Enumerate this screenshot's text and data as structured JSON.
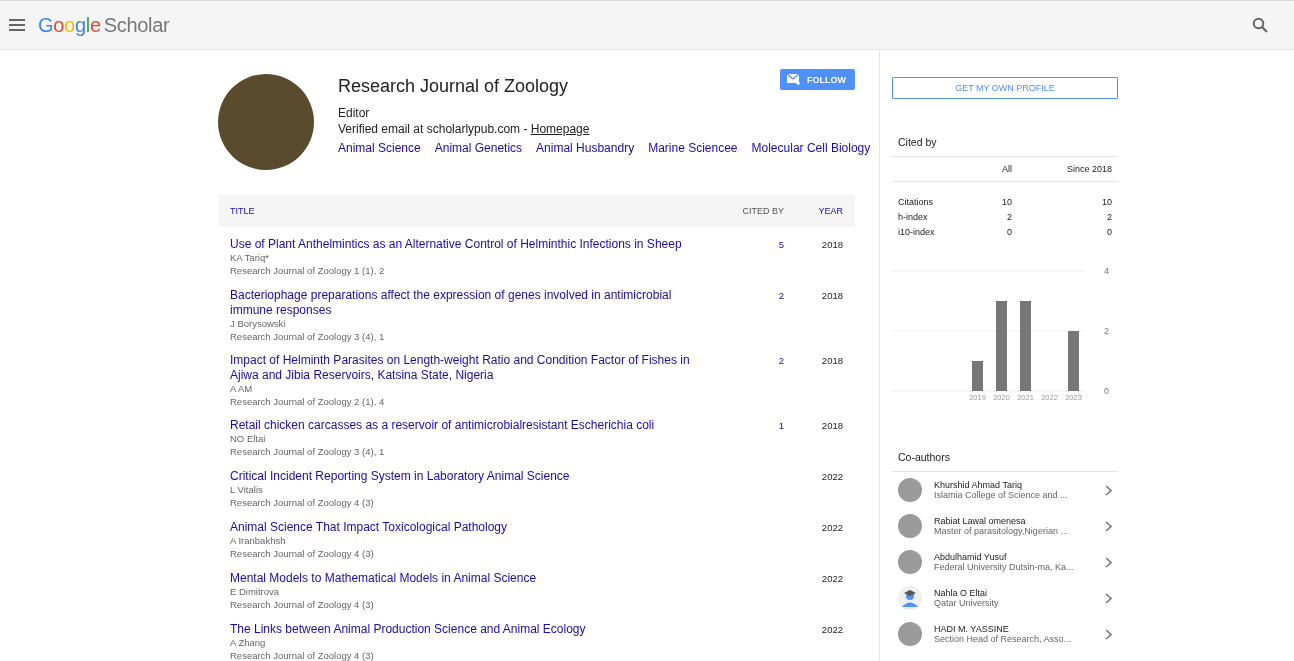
{
  "header": {
    "logo_brand": "Google",
    "logo_product": "Scholar"
  },
  "profile": {
    "name": "Research Journal of Zoology",
    "role": "Editor",
    "verified": "Verified email at scholarlypub.com - ",
    "homepage": "Homepage",
    "follow": "FOLLOW",
    "interests": [
      "Animal Science",
      "Animal Genetics",
      "Animal Husbandry",
      "Marine Sciencee",
      "Molecular Cell Biology"
    ]
  },
  "table": {
    "columns": [
      "TITLE",
      "CITED BY",
      "YEAR"
    ],
    "rows": [
      {
        "title": "Use of Plant Anthelmintics as an Alternative Control of Helminthic Infections in Sheep",
        "authors": "KA Tariq*",
        "source": "Research Journal of Zoology 1 (1), 2",
        "cited_by": "5",
        "year": "2018"
      },
      {
        "title": "Bacteriophage preparations affect the expression of genes involved in antimicrobial immune responses",
        "authors": "J Borysowski",
        "source": "Research Journal of Zoology 3 (4), 1",
        "cited_by": "2",
        "year": "2018"
      },
      {
        "title": "Impact of Helminth Parasites on Length-weight Ratio and Condition Factor of Fishes in Ajiwa and Jibia Reservoirs, Katsina State, Nigeria",
        "authors": "A AM",
        "source": "Research Journal of Zoology 2 (1), 4",
        "cited_by": "2",
        "year": "2018"
      },
      {
        "title": "Retail chicken carcasses as a reservoir of antimicrobialresistant Escherichia coli",
        "authors": "NO Eltai",
        "source": "Research Journal of Zoology 3 (4), 1",
        "cited_by": "1",
        "year": "2018"
      },
      {
        "title": "Critical Incident Reporting System in Laboratory Animal Science",
        "authors": "L Vitalis",
        "source": "Research Journal of Zoology 4 (3)",
        "year": "2022"
      },
      {
        "title": "Animal Science That Impact Toxicological Pathology",
        "authors": "A Iranbakhsh",
        "source": "Research Journal of Zoology 4 (3)",
        "year": "2022"
      },
      {
        "title": "Mental Models to Mathematical Models in Animal Science",
        "authors": "E Dimitrova",
        "source": "Research Journal of Zoology 4 (3)",
        "year": "2022"
      },
      {
        "title": "The Links between Animal Production Science and Animal Ecology",
        "authors": "A Zhang",
        "source": "Research Journal of Zoology 4 (3)",
        "year": "2022"
      }
    ]
  },
  "sidebar": {
    "own_profile": "GET MY OWN PROFILE",
    "cited_by": {
      "title": "Cited by",
      "columns": [
        "All",
        "Since 2018"
      ],
      "rows": [
        {
          "label": "Citations",
          "all": "10",
          "since": "10"
        },
        {
          "label": "h-index",
          "all": "2",
          "since": "2"
        },
        {
          "label": "i10-index",
          "all": "0",
          "since": "0"
        }
      ],
      "chart_data": {
        "type": "bar",
        "categories": [
          "2019",
          "2020",
          "2021",
          "2022",
          "2023"
        ],
        "values": [
          1,
          3,
          3,
          0,
          2
        ],
        "ylim": [
          0,
          4
        ],
        "yticks": [
          0,
          2,
          4
        ]
      }
    },
    "coauthors": {
      "title": "Co-authors",
      "items": [
        {
          "name": "Khurshid Ahmad Tariq",
          "affiliation": "Islamia College of Science and ...",
          "kind": "photo"
        },
        {
          "name": "Rabiat Lawal omenesa",
          "affiliation": "Master of parasitology,Nigerian ...",
          "kind": "photo"
        },
        {
          "name": "Abdulhamid Yusuf",
          "affiliation": "Federal University Dutsin-ma, Ka...",
          "kind": "photo"
        },
        {
          "name": "Nahla O Eltai",
          "affiliation": "Qatar University",
          "kind": "default"
        },
        {
          "name": "HADI M. YASSINE",
          "affiliation": "Section Head of Research, Asso...",
          "kind": "photo"
        }
      ]
    }
  }
}
